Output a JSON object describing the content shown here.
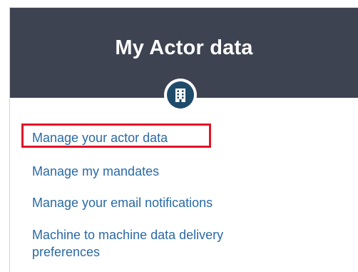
{
  "header": {
    "title": "My Actor data",
    "icon": "building-icon"
  },
  "links": [
    {
      "label": "Manage your actor data",
      "highlighted": true
    },
    {
      "label": "Manage my mandates"
    },
    {
      "label": "Manage your email notifications"
    },
    {
      "label": "Machine to machine data delivery preferences"
    }
  ],
  "colors": {
    "header_bg": "#3e4352",
    "badge_bg": "#1f4b6a",
    "link": "#2a6aa6",
    "highlight": "#e0142a"
  }
}
